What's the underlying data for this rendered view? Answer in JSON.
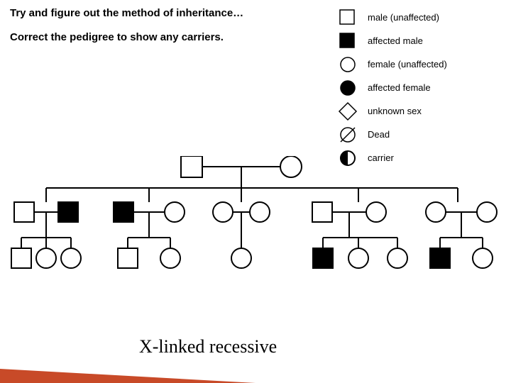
{
  "instructions": {
    "line1": "Try and figure out the method of inheritance…",
    "line2": "Correct the pedigree to show any carriers."
  },
  "legend": {
    "male_unaffected": "male (unaffected)",
    "affected_male": "affected male",
    "female_unaffected": "female (unaffected)",
    "affected_female": "affected female",
    "unknown_sex": "unknown sex",
    "dead": "Dead",
    "carrier": "carrier"
  },
  "answer": "X-linked recessive",
  "pedigree": {
    "generations": [
      {
        "gen": 1,
        "individuals": [
          {
            "id": "I-1",
            "sex": "male",
            "affected": false
          },
          {
            "id": "I-2",
            "sex": "female",
            "affected": false
          }
        ],
        "matings": [
          {
            "parents": [
              "I-1",
              "I-2"
            ],
            "children_mating_ids": [
              "m2a",
              "m2b",
              "m2c",
              "m2d",
              "m2e"
            ]
          }
        ]
      },
      {
        "gen": 2,
        "matings": [
          {
            "id": "m2a",
            "parents": [
              {
                "id": "II-1",
                "sex": "male",
                "affected": false,
                "married_in": true
              },
              {
                "id": "II-2",
                "sex": "male",
                "affected": true
              }
            ],
            "children": [
              {
                "id": "III-1",
                "sex": "male",
                "affected": false
              },
              {
                "id": "III-2",
                "sex": "female",
                "affected": false
              },
              {
                "id": "III-3",
                "sex": "female",
                "affected": false
              }
            ]
          },
          {
            "id": "m2b",
            "parents": [
              {
                "id": "II-3",
                "sex": "male",
                "affected": true
              },
              {
                "id": "II-4",
                "sex": "female",
                "affected": false,
                "married_in": true
              }
            ],
            "children": [
              {
                "id": "III-4",
                "sex": "male",
                "affected": false
              },
              {
                "id": "III-5",
                "sex": "female",
                "affected": false
              }
            ]
          },
          {
            "id": "m2c",
            "parents": [
              {
                "id": "II-5",
                "sex": "female",
                "affected": false
              },
              {
                "id": "II-6",
                "sex": "female",
                "affected": false,
                "married_in": true
              }
            ],
            "children": [
              {
                "id": "III-6",
                "sex": "female",
                "affected": false
              }
            ]
          },
          {
            "id": "m2d",
            "parents": [
              {
                "id": "II-7",
                "sex": "male",
                "affected": false,
                "married_in": true
              },
              {
                "id": "II-8",
                "sex": "female",
                "affected": false
              }
            ],
            "children": [
              {
                "id": "III-7",
                "sex": "male",
                "affected": true
              },
              {
                "id": "III-8",
                "sex": "female",
                "affected": false
              },
              {
                "id": "III-9",
                "sex": "female",
                "affected": false
              }
            ]
          },
          {
            "id": "m2e",
            "parents": [
              {
                "id": "II-9",
                "sex": "female",
                "affected": false
              },
              {
                "id": "II-10",
                "sex": "female",
                "affected": false,
                "married_in": true
              }
            ],
            "children": [
              {
                "id": "III-10",
                "sex": "male",
                "affected": true
              },
              {
                "id": "III-11",
                "sex": "female",
                "affected": false
              }
            ]
          }
        ]
      }
    ]
  }
}
